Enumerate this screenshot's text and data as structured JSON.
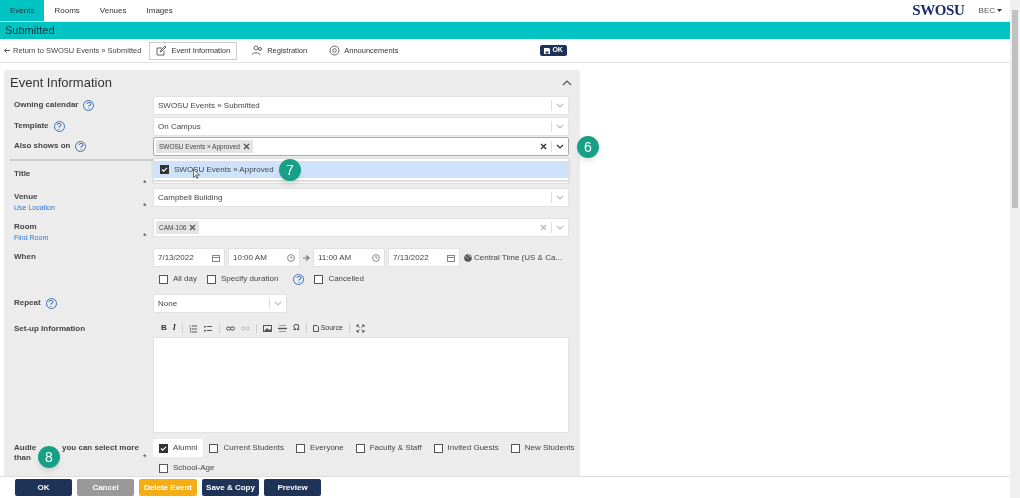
{
  "nav": {
    "tabs": [
      {
        "label": "Events",
        "selected": true
      },
      {
        "label": "Rooms",
        "selected": false
      },
      {
        "label": "Venues",
        "selected": false
      },
      {
        "label": "Images",
        "selected": false
      }
    ],
    "logo": "SWOSU",
    "user": "BEC"
  },
  "header": {
    "title": "Submitted"
  },
  "toolbar": {
    "back": "Return to SWOSU Events » Submitted",
    "tabs": [
      {
        "label": "Event Information",
        "kind": "edit",
        "selected": true
      },
      {
        "label": "Registration",
        "kind": "people",
        "selected": false
      },
      {
        "label": "Announcements",
        "kind": "at",
        "selected": false
      }
    ],
    "ok": "OK"
  },
  "panel": {
    "title": "Event Information",
    "expanded": true
  },
  "fields": [
    {
      "kind": "select",
      "label": "Owning calendar",
      "help": true,
      "value": "SWOSU Events » Submitted"
    },
    {
      "kind": "select",
      "label": "Template",
      "help": true,
      "value": "On Campus"
    },
    {
      "kind": "tags",
      "label": "Also shows on",
      "help": true,
      "tags": [
        "SWOSU Events » Approved"
      ],
      "open": true,
      "options": [
        {
          "label": "SWOSU Events » Approved",
          "checked": true
        }
      ]
    },
    {
      "kind": "text",
      "label": "Title",
      "required_mark": "*"
    },
    {
      "kind": "select",
      "label": "Venue",
      "required_mark": "*",
      "link": "Use Location",
      "value": "Campbell Building"
    },
    {
      "kind": "tags",
      "label": "Room",
      "required_mark": "*",
      "link": "Find Room",
      "tags": [
        "CAM-106"
      ],
      "open": false
    },
    {
      "kind": "when",
      "label": "When",
      "start_date": "7/13/2022",
      "start_time": "10:00 AM",
      "end_time": "11:00 AM",
      "end_date": "7/13/2022",
      "timezone": "Central Time (US & Ca...",
      "options": [
        {
          "label": "All day",
          "checked": false
        },
        {
          "label": "Specify duration",
          "checked": false,
          "help": true
        },
        {
          "label": "Cancelled",
          "checked": false
        }
      ]
    },
    {
      "kind": "small-select",
      "label": "Repeat",
      "help": true,
      "value": "None"
    },
    {
      "kind": "editor",
      "label": "Set-up Information",
      "tools": [
        {
          "kind": "bold",
          "text": "B"
        },
        {
          "kind": "italic",
          "text": "I"
        },
        {
          "kind": "ol"
        },
        {
          "kind": "ul"
        },
        {
          "kind": "link"
        },
        {
          "kind": "unlink"
        },
        {
          "kind": "image"
        },
        {
          "kind": "hr"
        },
        {
          "kind": "omega",
          "text": "Ω"
        },
        {
          "kind": "source",
          "text": "Source"
        },
        {
          "kind": "maximize"
        }
      ]
    },
    {
      "kind": "checks",
      "label_parts": [
        "Audie",
        "you can select more",
        "than"
      ],
      "required_mark": "*",
      "options": [
        {
          "label": "Alumni",
          "checked": true
        },
        {
          "label": "Current Students",
          "checked": false
        },
        {
          "label": "Everyone",
          "checked": false
        },
        {
          "label": "Faculty & Staff",
          "checked": false
        },
        {
          "label": "Invited Guests",
          "checked": false
        },
        {
          "label": "New Students",
          "checked": false
        },
        {
          "label": "School-Age",
          "checked": false
        }
      ]
    }
  ],
  "markers": [
    "6",
    "7",
    "8"
  ],
  "footer": [
    {
      "label": "OK",
      "kind": "primary"
    },
    {
      "label": "Cancel",
      "kind": "disabled"
    },
    {
      "label": "Delete Event",
      "kind": "warning"
    },
    {
      "label": "Save & Copy",
      "kind": "primary"
    },
    {
      "label": "Preview",
      "kind": "primary"
    }
  ]
}
